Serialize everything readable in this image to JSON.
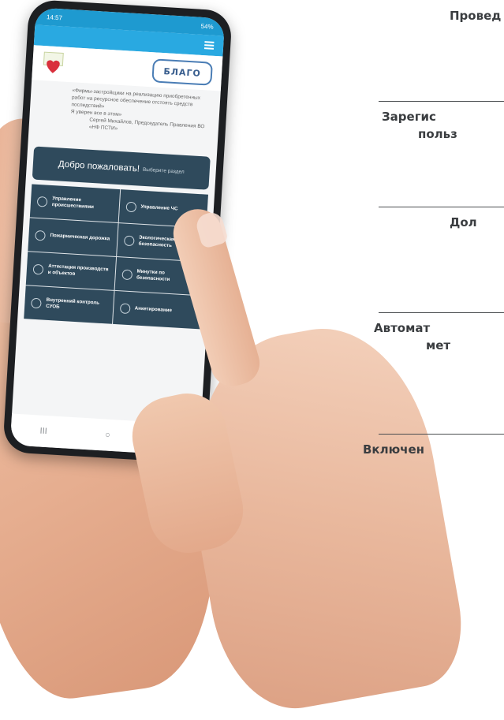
{
  "right_column": [
    "Провед",
    "Зарегис",
    "польз",
    "Дол",
    "Автомат",
    "мет",
    "Включен"
  ],
  "phone": {
    "status": {
      "time": "14:57",
      "right": "54%"
    },
    "logo_right": "БЛАГО",
    "intro": [
      "«Фирмы-застройщики на реализацию приобретенных",
      "работ на ресурсное обеспечение отстоять средств",
      "последствий»",
      "Я уверен все в этом»"
    ],
    "intro_signature": "Сергей Михайлов, Председатель Правления ВО «НФ ПСТИ»",
    "welcome_big": "Добро пожаловать!",
    "welcome_small": "Выберите раздел",
    "tiles": [
      "Управление происшествиями",
      "Управление ЧС",
      "Пожарническая дорожка",
      "Экологическая безопасность",
      "Аттестация производств и объектов",
      "Минутки по безопасности",
      "Внутренний контроль СУОБ",
      "Анкетирование"
    ],
    "nav": {
      "recent": "III",
      "home": "○",
      "back": "‹"
    }
  }
}
